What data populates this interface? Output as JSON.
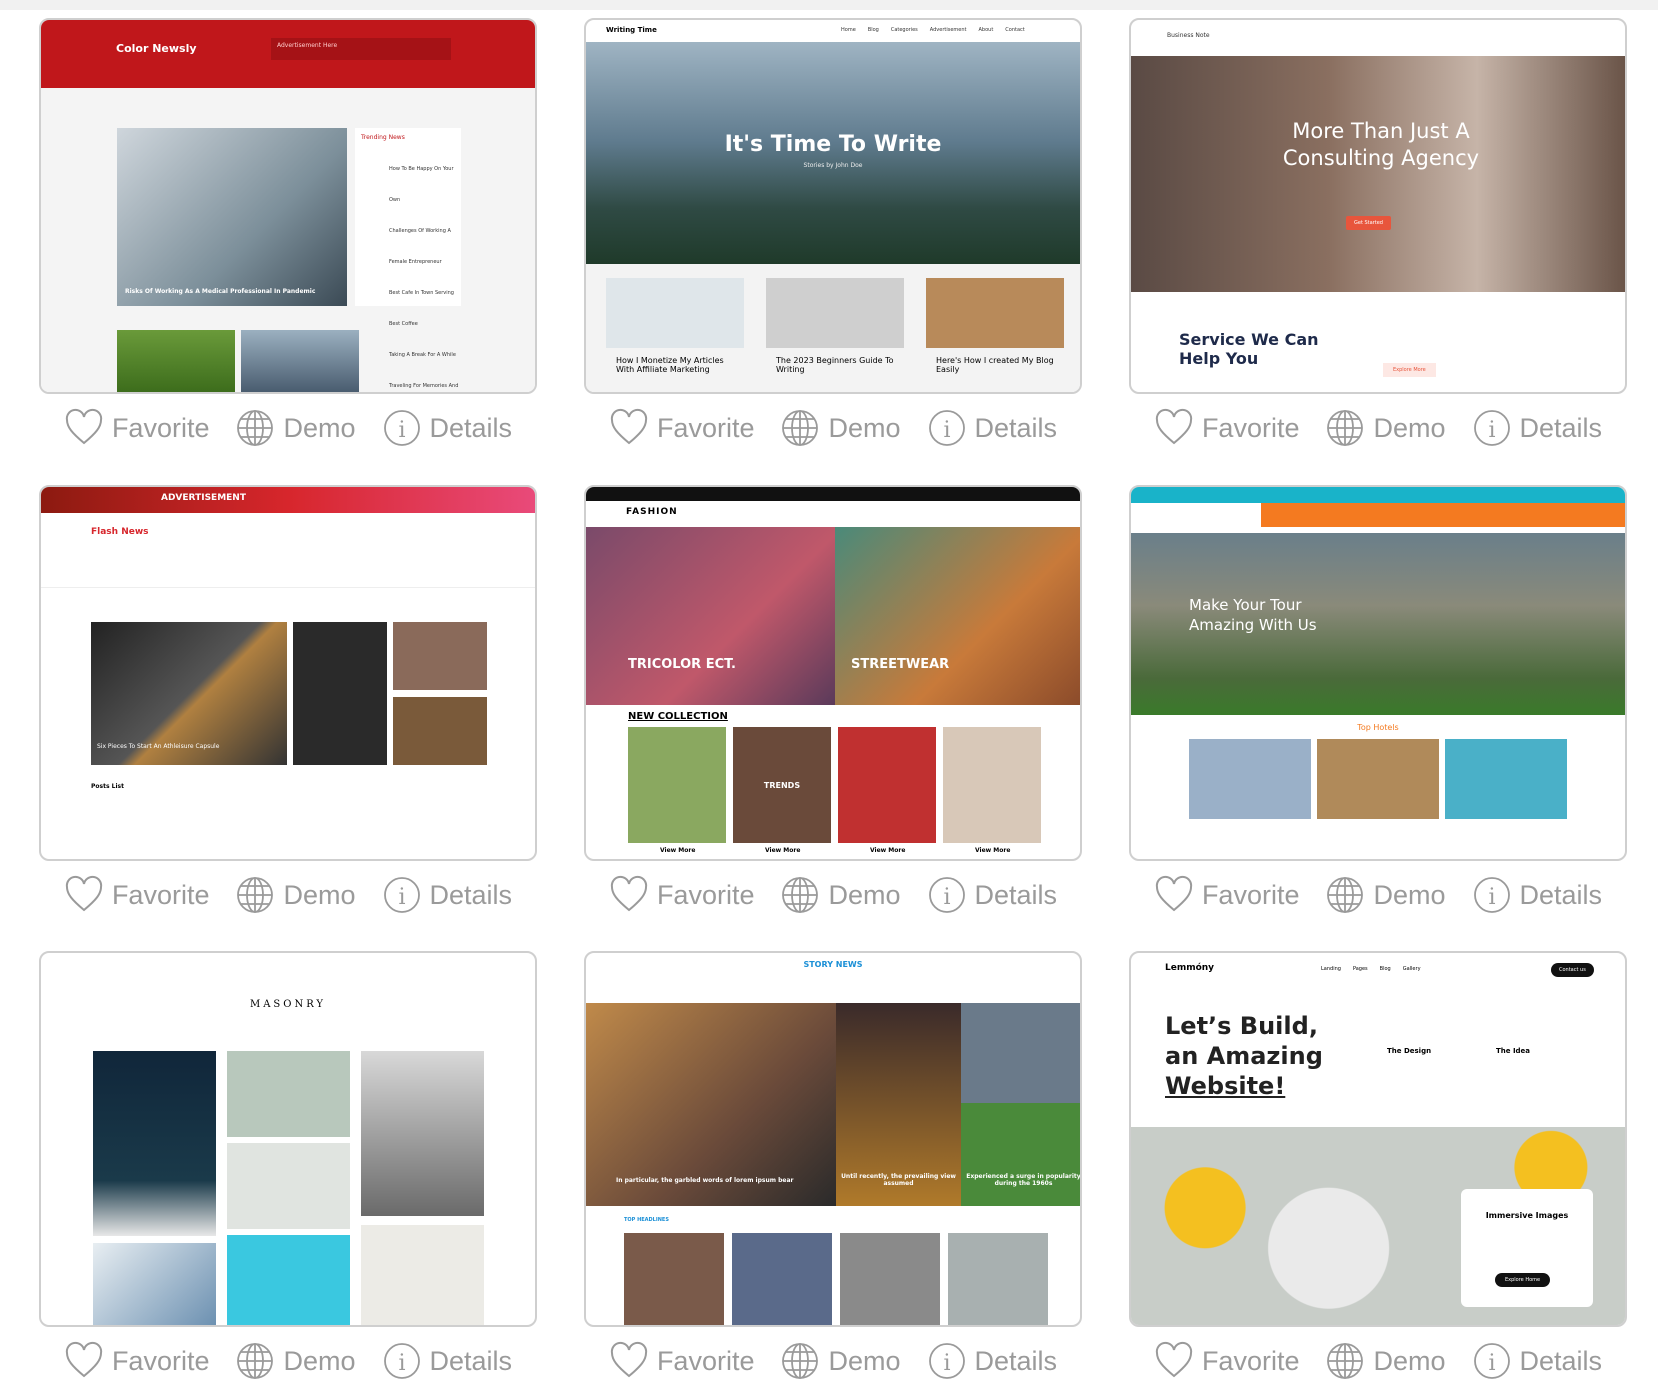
{
  "actions": {
    "favorite": "Favorite",
    "demo": "Demo",
    "details": "Details"
  },
  "themes": [
    {
      "brand": "Color Newsly",
      "ad": "Advertisement Here",
      "headline": "Risks Of Working As A Medical Professional In Pandemic",
      "sidebar_title": "Trending News",
      "side_items": [
        "How To Be Happy On Your Own",
        "Challenges Of Working A Female Entrepreneur",
        "Best Cafe In Town Serving Best Coffee",
        "Taking A Break For A While",
        "Traveling For Memories And Fun"
      ],
      "accent": "#c0171b"
    },
    {
      "brand": "Writing Time",
      "nav": [
        "Home",
        "Blog",
        "Categories",
        "Advertisement",
        "About",
        "Contact"
      ],
      "hero": "It's Time To Write",
      "sub": "Stories by John Doe",
      "posts": [
        "How I Monetize My Articles With Affiliate Marketing",
        "The 2023 Beginners Guide To Writing",
        "Here's How I created My Blog Easily"
      ]
    },
    {
      "brand": "Business Note",
      "hero": "More Than Just A Consulting Agency",
      "cta": "Get Started",
      "section": "Service We Can Help You",
      "more": "Explore More",
      "accent": "#e8553c"
    },
    {
      "ad": "ADVERTISEMENT",
      "brand": "Flash News",
      "headline": "Six Pieces To Start An Athleisure Capsule",
      "list": "Posts List",
      "accent": "#d7262c"
    },
    {
      "brand": "FASHION",
      "labels": [
        "TRICOLOR ECT.",
        "STREETWEAR"
      ],
      "collection": "NEW COLLECTION",
      "trends": "TRENDS",
      "view": "View More"
    },
    {
      "hero": "Make Your Tour Amazing With Us",
      "section": "Top Hotels",
      "accent": "#f47a20",
      "accent2": "#19b3c9"
    },
    {
      "brand": "MASONRY"
    },
    {
      "brand": "STORY NEWS",
      "captions": [
        "In particular, the garbled words of lorem ipsum bear",
        "Until recently, the prevailing view assumed",
        "Experienced a surge in popularity during the 1960s"
      ],
      "headlines": "TOP HEADLINES",
      "accent": "#1a8fd6"
    },
    {
      "brand": "Lemmóny",
      "nav": [
        "Landing",
        "Pages",
        "Blog",
        "Gallery"
      ],
      "contact": "Contact us",
      "hero": [
        "Let’s Build,",
        "an Amazing",
        "Website!"
      ],
      "features": [
        "The Design",
        "The Idea"
      ],
      "card_title": "Immersive Images",
      "explore": "Explore Home"
    }
  ]
}
